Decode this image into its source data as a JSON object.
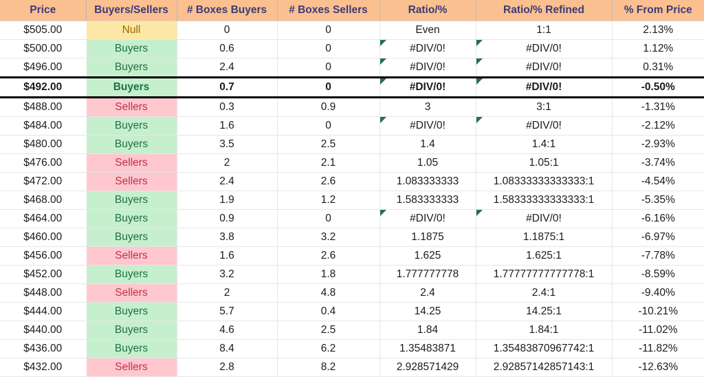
{
  "table": {
    "columns": [
      {
        "key": "price",
        "label": "Price",
        "class": "c-price"
      },
      {
        "key": "state",
        "label": "Buyers/Sellers",
        "class": "c-bs"
      },
      {
        "key": "boxes_buy",
        "label": "# Boxes Buyers",
        "class": "c-boxb"
      },
      {
        "key": "boxes_sell",
        "label": "# Boxes Sellers",
        "class": "c-boxs"
      },
      {
        "key": "ratio",
        "label": "Ratio/%",
        "class": "c-ratio"
      },
      {
        "key": "ratio_ref",
        "label": "Ratio/% Refined",
        "class": "c-ratior"
      },
      {
        "key": "pct",
        "label": "% From Price",
        "class": "c-pct"
      }
    ],
    "rows": [
      {
        "price": "$505.00",
        "state": "Null",
        "state_kind": "null",
        "boxes_buy": "0",
        "boxes_sell": "0",
        "ratio": "Even",
        "ratio_error": false,
        "ratio_ref": "1:1",
        "ratio_ref_error": false,
        "pct": "2.13%",
        "highlight": false
      },
      {
        "price": "$500.00",
        "state": "Buyers",
        "state_kind": "buyers",
        "boxes_buy": "0.6",
        "boxes_sell": "0",
        "ratio": "#DIV/0!",
        "ratio_error": true,
        "ratio_ref": "#DIV/0!",
        "ratio_ref_error": true,
        "pct": "1.12%",
        "highlight": false
      },
      {
        "price": "$496.00",
        "state": "Buyers",
        "state_kind": "buyers",
        "boxes_buy": "2.4",
        "boxes_sell": "0",
        "ratio": "#DIV/0!",
        "ratio_error": true,
        "ratio_ref": "#DIV/0!",
        "ratio_ref_error": true,
        "pct": "0.31%",
        "highlight": false
      },
      {
        "price": "$492.00",
        "state": "Buyers",
        "state_kind": "buyers",
        "boxes_buy": "0.7",
        "boxes_sell": "0",
        "ratio": "#DIV/0!",
        "ratio_error": true,
        "ratio_ref": "#DIV/0!",
        "ratio_ref_error": true,
        "pct": "-0.50%",
        "highlight": true
      },
      {
        "price": "$488.00",
        "state": "Sellers",
        "state_kind": "sellers",
        "boxes_buy": "0.3",
        "boxes_sell": "0.9",
        "ratio": "3",
        "ratio_error": false,
        "ratio_ref": "3:1",
        "ratio_ref_error": false,
        "pct": "-1.31%",
        "highlight": false
      },
      {
        "price": "$484.00",
        "state": "Buyers",
        "state_kind": "buyers",
        "boxes_buy": "1.6",
        "boxes_sell": "0",
        "ratio": "#DIV/0!",
        "ratio_error": true,
        "ratio_ref": "#DIV/0!",
        "ratio_ref_error": true,
        "pct": "-2.12%",
        "highlight": false
      },
      {
        "price": "$480.00",
        "state": "Buyers",
        "state_kind": "buyers",
        "boxes_buy": "3.5",
        "boxes_sell": "2.5",
        "ratio": "1.4",
        "ratio_error": false,
        "ratio_ref": "1.4:1",
        "ratio_ref_error": false,
        "pct": "-2.93%",
        "highlight": false
      },
      {
        "price": "$476.00",
        "state": "Sellers",
        "state_kind": "sellers",
        "boxes_buy": "2",
        "boxes_sell": "2.1",
        "ratio": "1.05",
        "ratio_error": false,
        "ratio_ref": "1.05:1",
        "ratio_ref_error": false,
        "pct": "-3.74%",
        "highlight": false
      },
      {
        "price": "$472.00",
        "state": "Sellers",
        "state_kind": "sellers",
        "boxes_buy": "2.4",
        "boxes_sell": "2.6",
        "ratio": "1.083333333",
        "ratio_error": false,
        "ratio_ref": "1.08333333333333:1",
        "ratio_ref_error": false,
        "pct": "-4.54%",
        "highlight": false
      },
      {
        "price": "$468.00",
        "state": "Buyers",
        "state_kind": "buyers",
        "boxes_buy": "1.9",
        "boxes_sell": "1.2",
        "ratio": "1.583333333",
        "ratio_error": false,
        "ratio_ref": "1.58333333333333:1",
        "ratio_ref_error": false,
        "pct": "-5.35%",
        "highlight": false
      },
      {
        "price": "$464.00",
        "state": "Buyers",
        "state_kind": "buyers",
        "boxes_buy": "0.9",
        "boxes_sell": "0",
        "ratio": "#DIV/0!",
        "ratio_error": true,
        "ratio_ref": "#DIV/0!",
        "ratio_ref_error": true,
        "pct": "-6.16%",
        "highlight": false
      },
      {
        "price": "$460.00",
        "state": "Buyers",
        "state_kind": "buyers",
        "boxes_buy": "3.8",
        "boxes_sell": "3.2",
        "ratio": "1.1875",
        "ratio_error": false,
        "ratio_ref": "1.1875:1",
        "ratio_ref_error": false,
        "pct": "-6.97%",
        "highlight": false
      },
      {
        "price": "$456.00",
        "state": "Sellers",
        "state_kind": "sellers",
        "boxes_buy": "1.6",
        "boxes_sell": "2.6",
        "ratio": "1.625",
        "ratio_error": false,
        "ratio_ref": "1.625:1",
        "ratio_ref_error": false,
        "pct": "-7.78%",
        "highlight": false
      },
      {
        "price": "$452.00",
        "state": "Buyers",
        "state_kind": "buyers",
        "boxes_buy": "3.2",
        "boxes_sell": "1.8",
        "ratio": "1.777777778",
        "ratio_error": false,
        "ratio_ref": "1.77777777777778:1",
        "ratio_ref_error": false,
        "pct": "-8.59%",
        "highlight": false
      },
      {
        "price": "$448.00",
        "state": "Sellers",
        "state_kind": "sellers",
        "boxes_buy": "2",
        "boxes_sell": "4.8",
        "ratio": "2.4",
        "ratio_error": false,
        "ratio_ref": "2.4:1",
        "ratio_ref_error": false,
        "pct": "-9.40%",
        "highlight": false
      },
      {
        "price": "$444.00",
        "state": "Buyers",
        "state_kind": "buyers",
        "boxes_buy": "5.7",
        "boxes_sell": "0.4",
        "ratio": "14.25",
        "ratio_error": false,
        "ratio_ref": "14.25:1",
        "ratio_ref_error": false,
        "pct": "-10.21%",
        "highlight": false
      },
      {
        "price": "$440.00",
        "state": "Buyers",
        "state_kind": "buyers",
        "boxes_buy": "4.6",
        "boxes_sell": "2.5",
        "ratio": "1.84",
        "ratio_error": false,
        "ratio_ref": "1.84:1",
        "ratio_ref_error": false,
        "pct": "-11.02%",
        "highlight": false
      },
      {
        "price": "$436.00",
        "state": "Buyers",
        "state_kind": "buyers",
        "boxes_buy": "8.4",
        "boxes_sell": "6.2",
        "ratio": "1.35483871",
        "ratio_error": false,
        "ratio_ref": "1.35483870967742:1",
        "ratio_ref_error": false,
        "pct": "-11.82%",
        "highlight": false
      },
      {
        "price": "$432.00",
        "state": "Sellers",
        "state_kind": "sellers",
        "boxes_buy": "2.8",
        "boxes_sell": "8.2",
        "ratio": "2.928571429",
        "ratio_error": false,
        "ratio_ref": "2.92857142857143:1",
        "ratio_ref_error": false,
        "pct": "-12.63%",
        "highlight": false
      }
    ]
  },
  "colors": {
    "header_bg": "#FAC090",
    "header_text": "#3B3B7A",
    "buyers_bg": "#C6EFCE",
    "buyers_text": "#1E7145",
    "sellers_bg": "#FFC7CE",
    "sellers_text": "#C0314B",
    "null_bg": "#FCE8A6",
    "null_text": "#9C6500",
    "error_flag": "#217346",
    "highlight_border": "#000000"
  }
}
